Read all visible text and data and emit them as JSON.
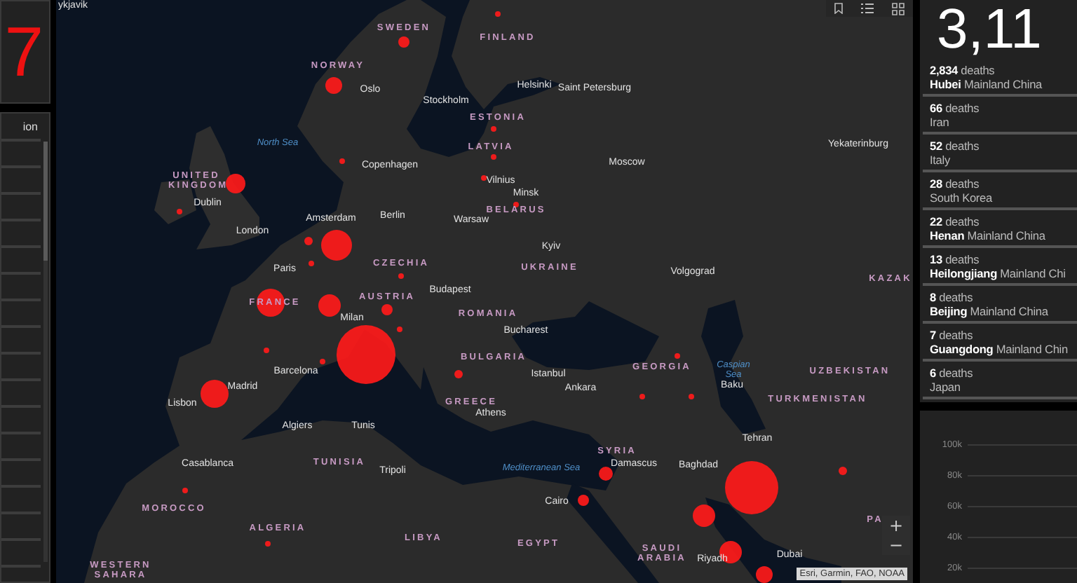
{
  "left_panel": {
    "total": "7",
    "header": "ion"
  },
  "map": {
    "labels": [
      {
        "kind": "city",
        "text": "ykjavik"
      },
      {
        "kind": "country",
        "text": "SWEDEN"
      },
      {
        "kind": "country",
        "text": "FINLAND"
      },
      {
        "kind": "country",
        "text": "NORWAY"
      },
      {
        "kind": "city",
        "text": "Oslo"
      },
      {
        "kind": "city",
        "text": "Stockholm"
      },
      {
        "kind": "city",
        "text": "Helsinki"
      },
      {
        "kind": "city",
        "text": "Saint Petersburg"
      },
      {
        "kind": "country",
        "text": "ESTONIA"
      },
      {
        "kind": "sea",
        "text": "North Sea"
      },
      {
        "kind": "country",
        "text": "LATVIA"
      },
      {
        "kind": "city",
        "text": "Yekaterinburg"
      },
      {
        "kind": "city",
        "text": "Copenhagen"
      },
      {
        "kind": "city",
        "text": "Moscow"
      },
      {
        "kind": "country",
        "text": "UNITED KINGDOM"
      },
      {
        "kind": "city",
        "text": "Vilnius"
      },
      {
        "kind": "city",
        "text": "Minsk"
      },
      {
        "kind": "city",
        "text": "Dublin"
      },
      {
        "kind": "city",
        "text": "Amsterdam"
      },
      {
        "kind": "city",
        "text": "Berlin"
      },
      {
        "kind": "city",
        "text": "Warsaw"
      },
      {
        "kind": "country",
        "text": "BELARUS"
      },
      {
        "kind": "city",
        "text": "London"
      },
      {
        "kind": "city",
        "text": "Kyiv"
      },
      {
        "kind": "city",
        "text": "Paris"
      },
      {
        "kind": "country",
        "text": "CZECHIA"
      },
      {
        "kind": "country",
        "text": "UKRAINE"
      },
      {
        "kind": "city",
        "text": "Volgograd"
      },
      {
        "kind": "country",
        "text": "KAZAK"
      },
      {
        "kind": "city",
        "text": "Budapest"
      },
      {
        "kind": "country",
        "text": "FRANCE"
      },
      {
        "kind": "country",
        "text": "AUSTRIA"
      },
      {
        "kind": "city",
        "text": "Milan"
      },
      {
        "kind": "country",
        "text": "ROMANIA"
      },
      {
        "kind": "city",
        "text": "Bucharest"
      },
      {
        "kind": "country",
        "text": "BULGARIA"
      },
      {
        "kind": "city",
        "text": "Barcelona"
      },
      {
        "kind": "city",
        "text": "Istanbul"
      },
      {
        "kind": "country",
        "text": "GEORGIA"
      },
      {
        "kind": "sea",
        "text": "Caspian Sea"
      },
      {
        "kind": "country",
        "text": "UZBEKISTAN"
      },
      {
        "kind": "city",
        "text": "Madrid"
      },
      {
        "kind": "city",
        "text": "Ankara"
      },
      {
        "kind": "city",
        "text": "Baku"
      },
      {
        "kind": "city",
        "text": "Lisbon"
      },
      {
        "kind": "country",
        "text": "GREECE"
      },
      {
        "kind": "country",
        "text": "TURKMENISTAN"
      },
      {
        "kind": "city",
        "text": "Athens"
      },
      {
        "kind": "city",
        "text": "Algiers"
      },
      {
        "kind": "city",
        "text": "Tunis"
      },
      {
        "kind": "city",
        "text": "Tehran"
      },
      {
        "kind": "country",
        "text": "SYRIA"
      },
      {
        "kind": "city",
        "text": "Casablanca"
      },
      {
        "kind": "country",
        "text": "TUNISIA"
      },
      {
        "kind": "city",
        "text": "Tripoli"
      },
      {
        "kind": "sea",
        "text": "Mediterranean Sea"
      },
      {
        "kind": "city",
        "text": "Damascus"
      },
      {
        "kind": "city",
        "text": "Baghdad"
      },
      {
        "kind": "city",
        "text": "Cairo"
      },
      {
        "kind": "country",
        "text": "MOROCCO"
      },
      {
        "kind": "country",
        "text": "ALGERIA"
      },
      {
        "kind": "country",
        "text": "PA"
      },
      {
        "kind": "country",
        "text": "LIBYA"
      },
      {
        "kind": "country",
        "text": "EGYPT"
      },
      {
        "kind": "country",
        "text": "WESTERN SAHARA"
      },
      {
        "kind": "country",
        "text": "SAUDI ARABIA"
      },
      {
        "kind": "city",
        "text": "Riyadh"
      },
      {
        "kind": "city",
        "text": "Dubai"
      }
    ],
    "zoom_in": "+",
    "zoom_out": "−",
    "attribution": "Esri, Garmin, FAO, NOAA"
  },
  "deaths_panel": {
    "total": "3,11",
    "items": [
      {
        "count_text": "**2,834** deaths",
        "location_text": "**Hubei** Mainland China"
      },
      {
        "count_text": "**66** deaths",
        "location_text": "Iran"
      },
      {
        "count_text": "**52** deaths",
        "location_text": "Italy"
      },
      {
        "count_text": "**28** deaths",
        "location_text": "South Korea"
      },
      {
        "count_text": "**22** deaths",
        "location_text": "**Henan** Mainland China"
      },
      {
        "count_text": "**13** deaths",
        "location_text": "**Heilongjiang** Mainland Chi"
      },
      {
        "count_text": "**8** deaths",
        "location_text": "**Beijing** Mainland China"
      },
      {
        "count_text": "**7** deaths",
        "location_text": "**Guangdong** Mainland Chin"
      },
      {
        "count_text": "**6** deaths",
        "location_text": "Japan"
      }
    ]
  },
  "chart": {
    "tick_labels": [
      "100k",
      "80k",
      "60k",
      "40k",
      "20k"
    ]
  }
}
